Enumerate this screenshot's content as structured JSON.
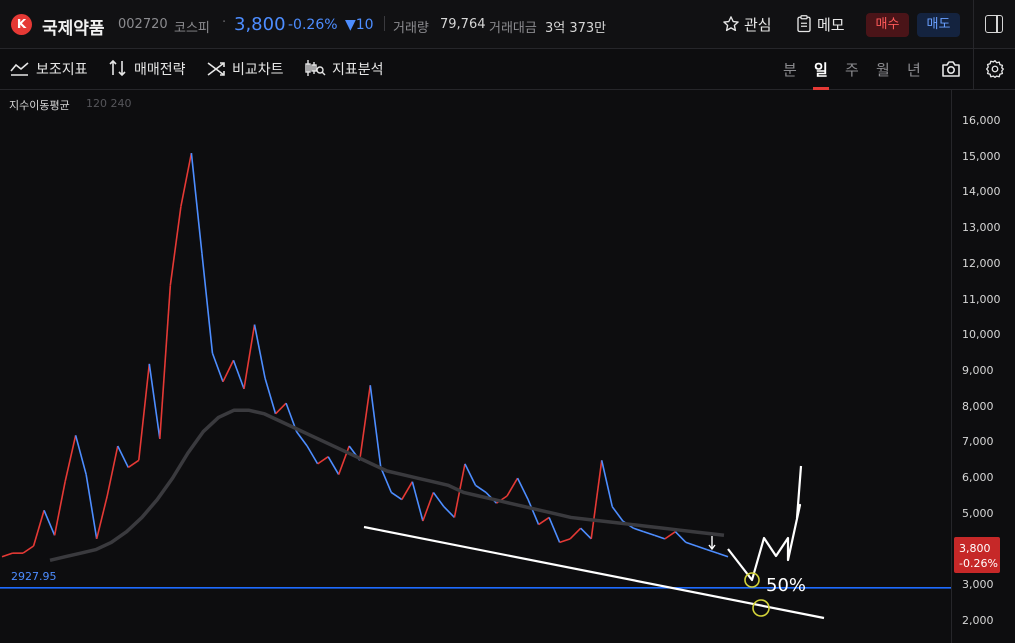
{
  "header": {
    "logo_letter": "K",
    "stock_name": "국제약품",
    "stock_code": "002720",
    "market": "코스피",
    "price": "3,800",
    "change_rate": "-0.26%",
    "change_amount": "▼10",
    "volume_label": "거래량",
    "volume_value": "79,764",
    "trade_value_label": "거래대금",
    "trade_value": "3억 373만",
    "favorite_label": "관심",
    "memo_label": "메모",
    "buy_label": "매수",
    "sell_label": "매도"
  },
  "toolbar": {
    "tools": [
      "보조지표",
      "매매전략",
      "비교차트",
      "지표분석"
    ],
    "periods": [
      "분",
      "일",
      "주",
      "월",
      "년"
    ],
    "active_period": "일"
  },
  "chart_data": {
    "type": "line",
    "indicator_label": "지수이동평균",
    "indicator_params": "120 240",
    "y_ticks": [
      "16,000",
      "15,000",
      "14,000",
      "13,000",
      "12,000",
      "11,000",
      "10,000",
      "9,000",
      "8,000",
      "7,000",
      "6,000",
      "5,000",
      "4,000",
      "3,000",
      "2,000"
    ],
    "ylim": [
      1800,
      16600
    ],
    "current_price_label": "3,800",
    "current_change_label": "-0.26%",
    "horizontal_level_label": "2927.95",
    "horizontal_level": 2927.95,
    "annotation_text": "50%",
    "price_series": [
      3800,
      3900,
      3900,
      4100,
      5100,
      4400,
      5900,
      7200,
      6100,
      4300,
      5500,
      6900,
      6300,
      6500,
      9200,
      7100,
      11400,
      13600,
      15100,
      12300,
      9500,
      8700,
      9300,
      8500,
      10300,
      8800,
      7800,
      8100,
      7300,
      6900,
      6400,
      6600,
      6100,
      6900,
      6500,
      8600,
      6300,
      5600,
      5400,
      5900,
      4800,
      5600,
      5200,
      4900,
      6400,
      5800,
      5600,
      5300,
      5500,
      6000,
      5400,
      4700,
      4900,
      4200,
      4300,
      4600,
      4300,
      6500,
      5200,
      4800,
      4600,
      4500,
      4400,
      4300,
      4500,
      4200,
      4100,
      4000,
      3900,
      3800
    ],
    "ma120_series": [
      3700,
      3800,
      3900,
      4000,
      4200,
      4500,
      4900,
      5400,
      6000,
      6700,
      7300,
      7700,
      7900,
      7900,
      7800,
      7600,
      7400,
      7200,
      7000,
      6800,
      6600,
      6400,
      6200,
      6100,
      6000,
      5900,
      5800,
      5600,
      5500,
      5400,
      5300,
      5200,
      5100,
      5000,
      4900,
      4850,
      4800,
      4750,
      4700,
      4650,
      4600,
      4550,
      4500,
      4450,
      4400
    ],
    "trendline_label": "",
    "projection": [
      3800,
      3100,
      4300,
      3700,
      4500,
      3900,
      5000,
      4700,
      6300
    ]
  },
  "colors": {
    "up": "#e53935",
    "down": "#4d8dff",
    "background": "#0d0d0f",
    "level_line": "#1e6bff",
    "highlight_circle": "#d4d43a"
  }
}
